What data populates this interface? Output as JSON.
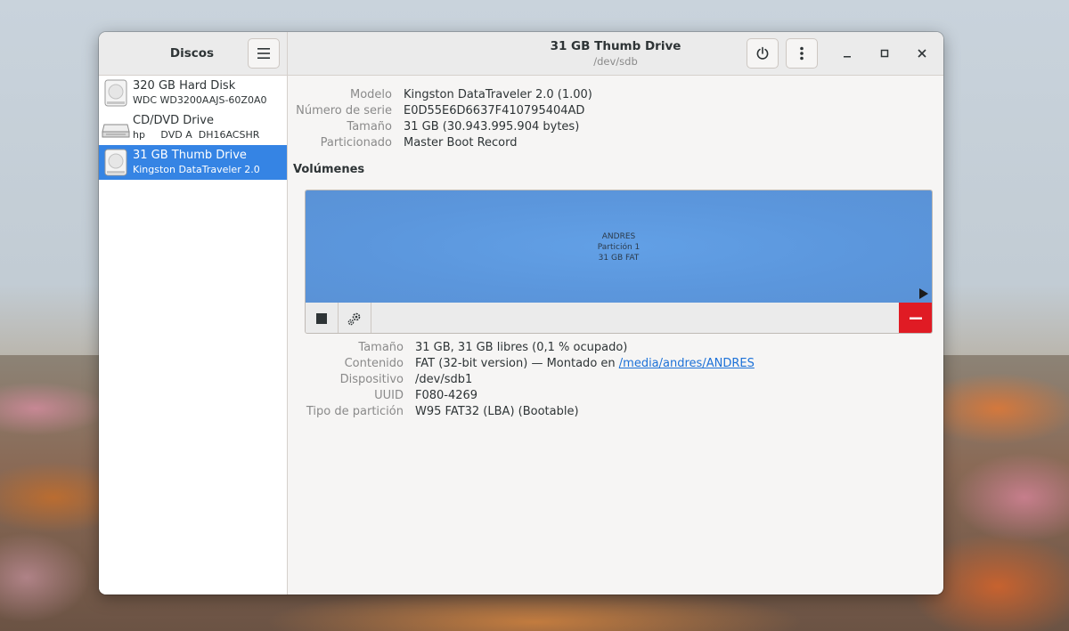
{
  "sidebar": {
    "title": "Discos",
    "disks": [
      {
        "name": "320 GB Hard Disk",
        "model": "WDC WD3200AAJS-60Z0A0",
        "icon": "hard-disk-icon"
      },
      {
        "name": "CD/DVD Drive",
        "model": "hp     DVD A  DH16ACSHR",
        "icon": "optical-drive-icon"
      },
      {
        "name": "31 GB Thumb Drive",
        "model": "Kingston DataTraveler 2.0",
        "icon": "usb-drive-icon"
      }
    ]
  },
  "header": {
    "title": "31 GB Thumb Drive",
    "subtitle": "/dev/sdb"
  },
  "drive": {
    "model_label": "Modelo",
    "model_value": "Kingston DataTraveler 2.0 (1.00)",
    "serial_label": "Número de serie",
    "serial_value": "E0D55E6D6637F410795404AD",
    "size_label": "Tamaño",
    "size_value": "31 GB (30.943.995.904 bytes)",
    "partitioning_label": "Particionado",
    "partitioning_value": "Master Boot Record"
  },
  "volumes": {
    "title": "Volúmenes",
    "partition": {
      "name": "ANDRES",
      "label": "Partición 1",
      "size": "31 GB FAT"
    }
  },
  "volume_details": {
    "size_label": "Tamaño",
    "size_value": "31 GB, 31 GB libres (0,1 % ocupado)",
    "content_label": "Contenido",
    "content_value": "FAT (32-bit version) — Montado en ",
    "mount_link": "/media/andres/ANDRES",
    "device_label": "Dispositivo",
    "device_value": "/dev/sdb1",
    "uuid_label": "UUID",
    "uuid_value": "F080-4269",
    "ptype_label": "Tipo de partición",
    "ptype_value": "W95 FAT32 (LBA) (Bootable)"
  },
  "colors": {
    "accent": "#3584e4",
    "partition": "#62a0e6",
    "destructive": "#e01b24",
    "link": "#1c71d8"
  }
}
